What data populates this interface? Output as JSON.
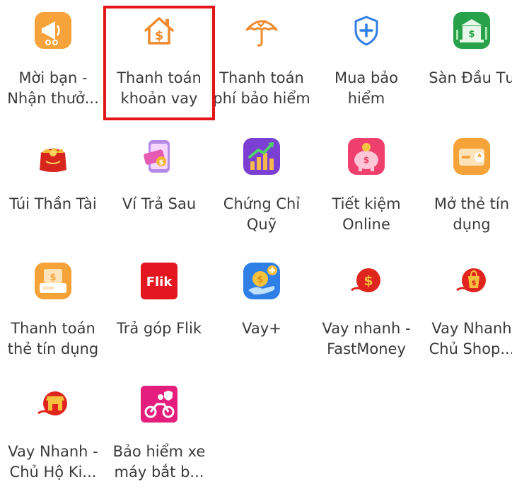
{
  "highlight_color": "#e3161b",
  "services": [
    {
      "line1": "Mời bạn -",
      "line2": "Nhận thưở...",
      "icon": "megaphone-icon"
    },
    {
      "line1": "Thanh toán",
      "line2": "khoản vay",
      "icon": "house-dollar-icon"
    },
    {
      "line1": "Thanh toán",
      "line2": "phí bảo hiểm",
      "icon": "umbrella-icon"
    },
    {
      "line1": "Mua bảo",
      "line2": "hiểm",
      "icon": "shield-plus-icon"
    },
    {
      "line1": "Sàn Đầu Tư",
      "line2": "",
      "icon": "bank-building-icon"
    },
    {
      "line1": "Túi Thần Tài",
      "line2": "",
      "icon": "lucky-bag-icon"
    },
    {
      "line1": "Ví Trả Sau",
      "line2": "",
      "icon": "phone-wallet-icon"
    },
    {
      "line1": "Chứng Chỉ",
      "line2": "Quỹ",
      "icon": "growth-chart-icon"
    },
    {
      "line1": "Tiết kiệm",
      "line2": "Online",
      "icon": "piggy-bank-icon"
    },
    {
      "line1": "Mở thẻ tín",
      "line2": "dụng",
      "icon": "credit-card-icon"
    },
    {
      "line1": "Thanh toán",
      "line2": "thẻ tín dụng",
      "icon": "card-payment-icon"
    },
    {
      "line1": "Trả góp Flik",
      "line2": "",
      "icon": "flik-logo-icon"
    },
    {
      "line1": "Vay+",
      "line2": "",
      "icon": "coin-hand-icon"
    },
    {
      "line1": "Vay nhanh -",
      "line2": "FastMoney",
      "icon": "fast-dollar-icon"
    },
    {
      "line1": "Vay Nhanh",
      "line2": "Chủ Shop...",
      "icon": "shopping-bag-icon"
    },
    {
      "line1": "Vay Nhanh -",
      "line2": "Chủ Hộ Ki...",
      "icon": "storefront-icon"
    },
    {
      "line1": "Bảo hiểm xe",
      "line2": "máy bắt b...",
      "icon": "motorbike-icon"
    }
  ],
  "flik_text": "Flik"
}
